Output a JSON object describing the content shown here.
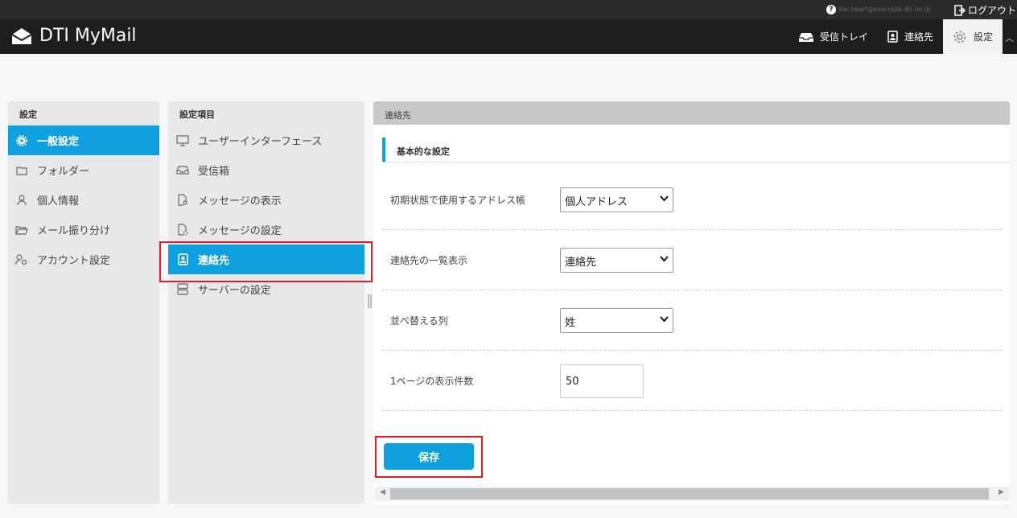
{
  "topbar": {
    "help_symbol": "?",
    "account": "bar.heart@example.dti.ne.jp",
    "logout_label": "ログアウト"
  },
  "header": {
    "app_title": "DTI MyMail",
    "nav": [
      {
        "label": "受信トレイ",
        "icon": "inbox-icon"
      },
      {
        "label": "連絡先",
        "icon": "contact-icon"
      },
      {
        "label": "設定",
        "icon": "gear-icon",
        "active": true
      }
    ]
  },
  "left_panel": {
    "title": "設定",
    "items": [
      {
        "label": "一般設定",
        "icon": "gear-icon",
        "selected": true
      },
      {
        "label": "フォルダー",
        "icon": "folder-icon"
      },
      {
        "label": "個人情報",
        "icon": "person-icon"
      },
      {
        "label": "メール振り分け",
        "icon": "folder-open-icon"
      },
      {
        "label": "アカウント設定",
        "icon": "account-gear-icon"
      }
    ]
  },
  "middle_panel": {
    "title": "設定項目",
    "items": [
      {
        "label": "ユーザーインターフェース",
        "icon": "monitor-icon"
      },
      {
        "label": "受信箱",
        "icon": "inbox-icon"
      },
      {
        "label": "メッセージの表示",
        "icon": "document-view-icon"
      },
      {
        "label": "メッセージの設定",
        "icon": "document-gear-icon"
      },
      {
        "label": "連絡先",
        "icon": "contact-icon",
        "selected": true
      },
      {
        "label": "サーバーの設定",
        "icon": "server-icon"
      }
    ]
  },
  "right_panel": {
    "title": "連絡先",
    "section_title": "基本的な設定",
    "fields": [
      {
        "label": "初期状態で使用するアドレス帳",
        "value": "個人アドレス",
        "type": "select"
      },
      {
        "label": "連絡先の一覧表示",
        "value": "連絡先",
        "type": "select"
      },
      {
        "label": "並べ替える列",
        "value": "姓",
        "type": "select"
      },
      {
        "label": "1ページの表示件数",
        "value": "50",
        "type": "input"
      }
    ],
    "save_label": "保存"
  },
  "colors": {
    "accent": "#0fa0e0",
    "header_bg": "#1e1e1e",
    "highlight": "#e02020"
  }
}
